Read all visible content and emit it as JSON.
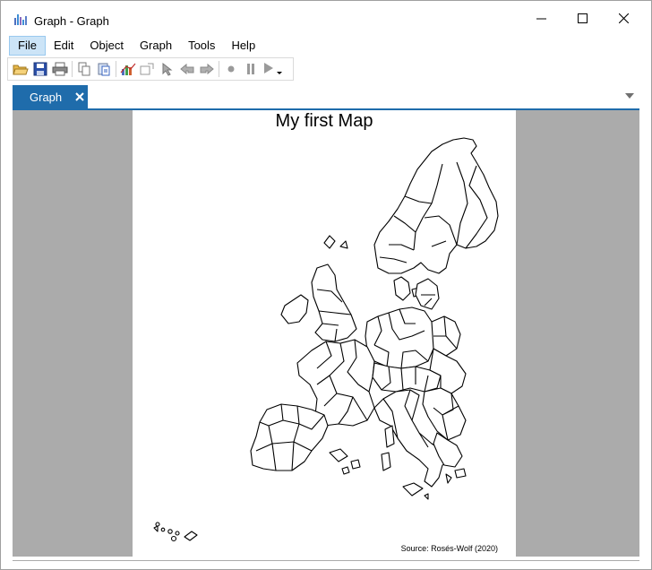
{
  "window": {
    "title": "Graph - Graph",
    "app_icon": "bar-chart-icon"
  },
  "menu": {
    "items": [
      {
        "label": "File",
        "active": true
      },
      {
        "label": "Edit"
      },
      {
        "label": "Object"
      },
      {
        "label": "Graph"
      },
      {
        "label": "Tools"
      },
      {
        "label": "Help"
      }
    ]
  },
  "toolbar": {
    "icons": [
      "open-folder-icon",
      "save-icon",
      "print-icon",
      "copy-icon",
      "paste-icon",
      "graph-icon",
      "insert-object-icon",
      "pointer-icon",
      "undo-icon",
      "redo-icon",
      "record-icon",
      "pause-icon",
      "play-icon"
    ]
  },
  "tabs": [
    {
      "label": "Graph",
      "active": true
    }
  ],
  "graph": {
    "title": "My first Map",
    "source": "Source: Rosés-Wolf (2020)",
    "stroke_color": "#000000",
    "fill_color": "#ffffff"
  },
  "colors": {
    "tab_active": "#1f6cab",
    "menu_active": "#cce4f7",
    "canvas_bg": "#ababab"
  }
}
